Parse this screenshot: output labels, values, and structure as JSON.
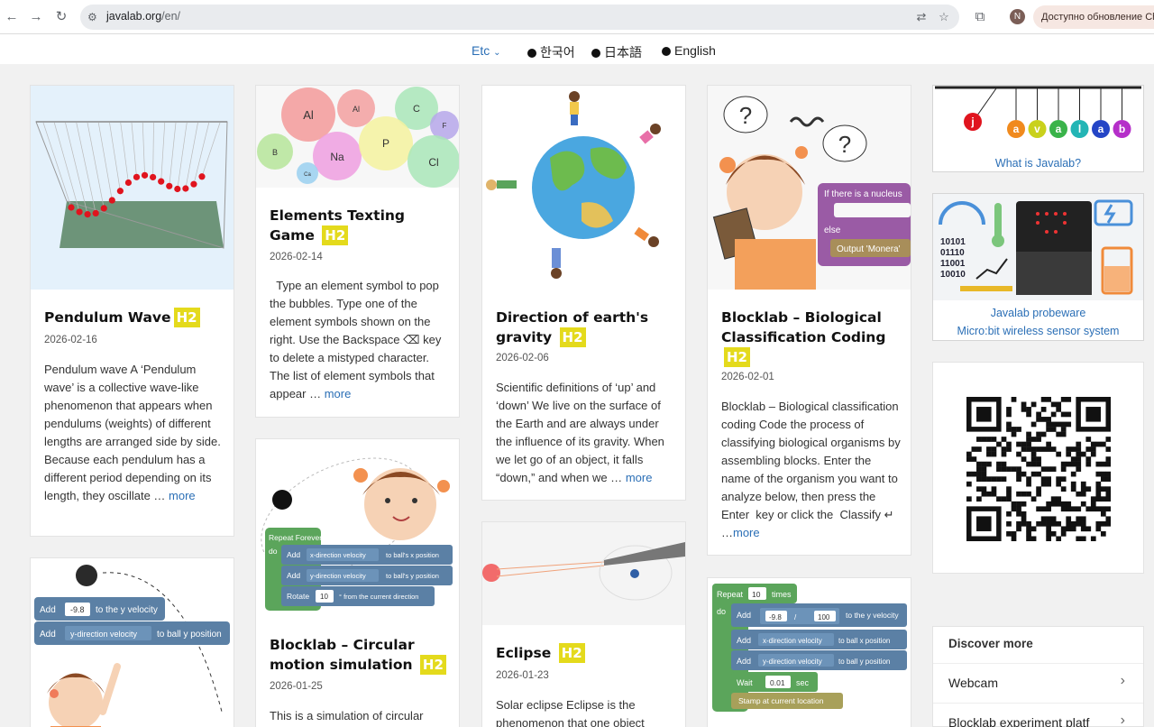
{
  "browser": {
    "url_host": "javalab.org",
    "url_path": "/en/",
    "avatar_initial": "N",
    "update_text": "Доступно обновление Ch"
  },
  "langbar": {
    "current": "Etc",
    "options": [
      "한국어",
      "日本語",
      "English"
    ]
  },
  "posts": [
    {
      "title": "Pendulum Wave",
      "badge": "H2",
      "date": "2026-02-16",
      "excerpt": "Pendulum wave A ‘Pendulum wave’ is a collective wave-like phenomenon that appears when pendulums (weights) of different lengths are arranged side by side. Because each pendulum has a different period depending on its length, they oscillate …",
      "more": "more"
    },
    {
      "title": "Elements Texting Game",
      "badge": "H2",
      "date": "2026-02-14",
      "excerpt": "  Type an element symbol to pop the bubbles. Type one of the element symbols shown on the right. Use the Backspace ⌫ key to delete a mistyped character. The list of element symbols that appear …",
      "more": "more",
      "bubbles": [
        "Al",
        "Al",
        "C",
        "B",
        "Na",
        "P",
        "F",
        "Cl",
        "Ca"
      ]
    },
    {
      "title": "Direction of earth's gravity",
      "badge": "H2",
      "date": "2026-02-06",
      "excerpt": "Scientific definitions of ‘up’ and ‘down’ We live on the surface of the Earth and are always under the influence of its gravity. When we let go of an object, it falls “down,” and when we …",
      "more": "more"
    },
    {
      "title": "Blocklab – Biological Classification Coding",
      "badge": "H2",
      "date": "2026-02-01",
      "excerpt": "Blocklab – Biological classification coding Code the process of classifying biological organisms by assembling blocks. Enter the name of the organism you want to analyze below, then press the  Enter  key or click the  Classify ↵  …",
      "more": "more",
      "blocks": [
        "If there is a nucleus",
        "else",
        "Output 'Monera'"
      ]
    },
    {
      "title": "Blocklab – Circular motion simulation",
      "badge": "H2",
      "date": "2026-01-25",
      "excerpt": "This is a simulation of circular",
      "blocks": [
        "Repeat Forever",
        "do",
        "Add",
        "x-direction velocity",
        "to ball's x position",
        "Add",
        "y-direction velocity",
        "to ball's y position",
        "Rotate",
        "10",
        "° from the current direction"
      ]
    },
    {
      "title": "Eclipse",
      "badge": "H2",
      "date": "2026-01-23",
      "excerpt": "Solar eclipse Eclipse is the phenomenon that one object"
    },
    {
      "blocks": [
        "Add",
        "-9.8",
        "to the y velocity",
        "Add",
        "y-direction velocity",
        "to ball y position"
      ]
    },
    {
      "blocks": [
        "Repeat",
        "10",
        "times",
        "do",
        "Add",
        "-9.8",
        "/",
        "100",
        "to the y velocity",
        "Add",
        "x-direction velocity",
        "to ball x position",
        "Add",
        "y-direction velocity",
        "to ball y position",
        "Wait",
        "0.01",
        "sec",
        "Stamp at current location"
      ]
    }
  ],
  "sidebar": {
    "logo_letters": [
      "j",
      "a",
      "v",
      "a",
      "l",
      "a",
      "b"
    ],
    "what_is": "What is Javalab?",
    "probeware_title": "Javalab probeware",
    "probeware_sub": "Micro:bit wireless sensor system",
    "binary": [
      "10101",
      "01110",
      "11001",
      "10010"
    ],
    "discover": {
      "heading": "Discover more",
      "items": [
        "Webcam",
        "Blocklab experiment platf"
      ]
    }
  },
  "colors": {
    "badge": "#e4da1c",
    "link": "#2b6fb6",
    "block_blue": "#5b80a5",
    "block_green": "#5ba55b",
    "block_purple": "#9a5ba5"
  }
}
